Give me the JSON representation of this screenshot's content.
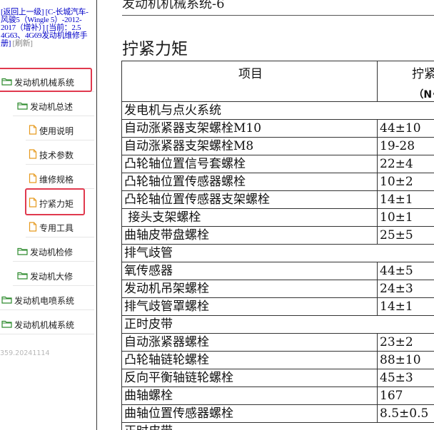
{
  "nav": {
    "back_link": "[返回上一级]",
    "breadcrumb": "[C-长城汽车-风骏5（Wingle 5）-2012-2017（增补）]",
    "current_prefix": "[当前：",
    "current_link": "2.5 4G63、4G69发动机维修手册",
    "current_suffix": "]",
    "refresh": "[刷新]"
  },
  "tree": [
    {
      "label": "发动机机械系统",
      "icon": "folder-icon",
      "highlighted": true
    },
    {
      "label": "发动机总述",
      "icon": "folder-icon"
    },
    {
      "label": "使用说明",
      "icon": "document-icon"
    },
    {
      "label": "技术参数",
      "icon": "document-icon"
    },
    {
      "label": "维修规格",
      "icon": "document-icon"
    },
    {
      "label": "拧紧力矩",
      "icon": "document-icon",
      "highlighted": true
    },
    {
      "label": "专用工具",
      "icon": "document-icon"
    },
    {
      "label": "发动机检修",
      "icon": "folder-icon"
    },
    {
      "label": "发动机大修",
      "icon": "folder-icon"
    },
    {
      "label": "发动机电喷系统",
      "icon": "folder-icon"
    },
    {
      "label": "发动机机械系统",
      "icon": "folder-icon"
    }
  ],
  "version": "359.20241114",
  "content": {
    "section_title": "发动机机械系统-6",
    "page_heading": "拧紧力矩",
    "table": {
      "headers": {
        "item": "项目",
        "torque": "拧紧力矩",
        "unit": "（N•m）"
      },
      "rows": [
        {
          "group": "发电机与点火系统"
        },
        {
          "name": "自动涨紧器支架螺栓M10",
          "value": "44±10"
        },
        {
          "name": "自动涨紧器支架螺栓M8",
          "value": "19-28"
        },
        {
          "name": "凸轮轴位置信号套螺栓",
          "value": "22±4"
        },
        {
          "name": "凸轮轴位置传感器螺栓",
          "value": "10±2"
        },
        {
          "name": "凸轮轴位置传感器支架螺栓",
          "value": "14±1"
        },
        {
          "name": " 接头支架螺栓",
          "value": "10±1"
        },
        {
          "name": "曲轴皮带盘螺栓",
          "value": "25±5"
        },
        {
          "group": "排气歧管"
        },
        {
          "name": "氧传感器",
          "value": "44±5"
        },
        {
          "name": "发动机吊架螺栓",
          "value": "24±3"
        },
        {
          "name": "排气歧管罩螺栓",
          "value": "14±1"
        },
        {
          "group": "正时皮带"
        },
        {
          "name": "自动涨紧器螺栓",
          "value": "23±2"
        },
        {
          "name": "凸轮轴链轮螺栓",
          "value": "88±10"
        },
        {
          "name": "反向平衡轴链轮螺栓",
          "value": "45±3"
        },
        {
          "name": "曲轴螺栓",
          "value": "167"
        },
        {
          "name": "曲轴位置传感器螺栓",
          "value": "8.5±0.5"
        },
        {
          "group": "正时皮带"
        }
      ]
    }
  },
  "colors": {
    "link": "#0000c8",
    "highlight": "#e0394e",
    "folder_green": "#2e8b2e",
    "doc_orange": "#e69a1f"
  }
}
